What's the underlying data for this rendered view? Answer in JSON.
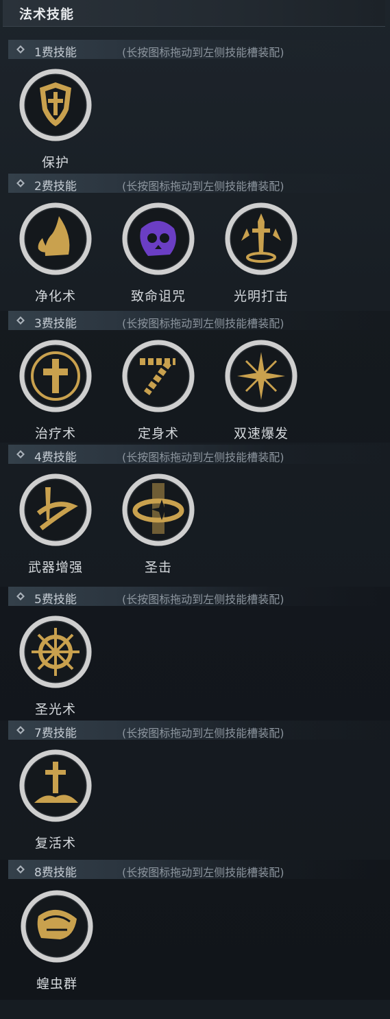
{
  "panel_title": "法术技能",
  "hint_text": "(长按图标拖动到左侧技能槽装配)",
  "colors": {
    "gold": "#c9a14e",
    "purple": "#6b3ec4",
    "ring": "#cfcfcf",
    "dark": "#14181c"
  },
  "sections": [
    {
      "cost": "1费技能",
      "skills": [
        {
          "name": "保护",
          "icon": "shield-icon"
        }
      ]
    },
    {
      "cost": "2费技能",
      "skills": [
        {
          "name": "净化术",
          "icon": "flames-icon"
        },
        {
          "name": "致命诅咒",
          "icon": "skull-icon"
        },
        {
          "name": "光明打击",
          "icon": "sword-icon"
        }
      ]
    },
    {
      "cost": "3费技能",
      "skills": [
        {
          "name": "治疗术",
          "icon": "cross-icon"
        },
        {
          "name": "定身术",
          "icon": "chain-icon"
        },
        {
          "name": "双速爆发",
          "icon": "starburst-icon"
        }
      ]
    },
    {
      "cost": "4费技能",
      "skills": [
        {
          "name": "武器增强",
          "icon": "enchanted-sword-icon"
        },
        {
          "name": "圣击",
          "icon": "holy-strike-icon"
        }
      ]
    },
    {
      "cost": "5费技能",
      "skills": [
        {
          "name": "圣光术",
          "icon": "sun-wheel-icon"
        }
      ]
    },
    {
      "cost": "7费技能",
      "skills": [
        {
          "name": "复活术",
          "icon": "grave-cross-icon"
        }
      ]
    },
    {
      "cost": "8费技能",
      "skills": [
        {
          "name": "蝗虫群",
          "icon": "locust-icon"
        }
      ]
    }
  ]
}
